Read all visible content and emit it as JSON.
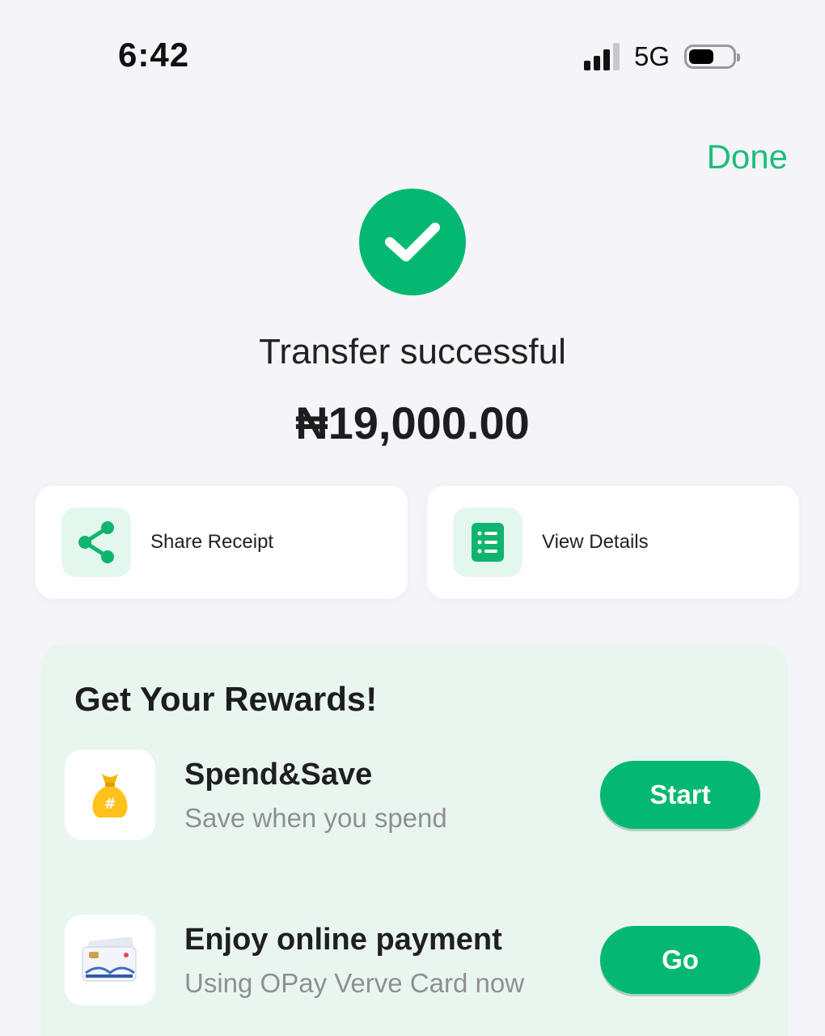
{
  "status_bar": {
    "time": "6:42",
    "network": "5G",
    "signal_icon": "cellular-signal-icon",
    "battery_icon": "battery-icon"
  },
  "header": {
    "done_label": "Done"
  },
  "result": {
    "icon": "check-circle-icon",
    "title": "Transfer successful",
    "amount": "₦19,000.00"
  },
  "actions": [
    {
      "label": "Share Receipt",
      "icon": "share-icon"
    },
    {
      "label": "View Details",
      "icon": "document-list-icon"
    }
  ],
  "rewards": {
    "title": "Get Your Rewards!",
    "items": [
      {
        "name": "Spend&Save",
        "description": "Save when you spend",
        "button": "Start",
        "icon": "money-bag-icon"
      },
      {
        "name": "Enjoy online payment",
        "description": "Using OPay Verve Card now",
        "button": "Go",
        "icon": "verve-card-icon"
      }
    ]
  },
  "colors": {
    "accent": "#05b871",
    "accent_text": "#1dbd7c",
    "panel_bg": "#e9f6ef",
    "page_bg": "#f5f5f9"
  }
}
